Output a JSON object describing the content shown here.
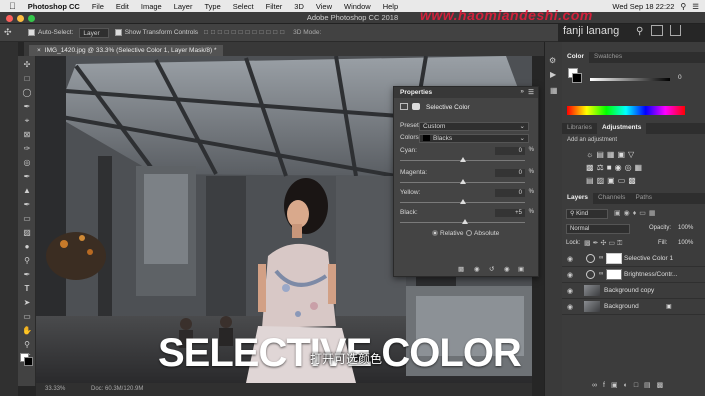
{
  "menubar": {
    "app_name": "Photoshop CC",
    "items": [
      "File",
      "Edit",
      "Image",
      "Layer",
      "Type",
      "Select",
      "Filter",
      "3D",
      "View",
      "Window",
      "Help"
    ],
    "clock": "Wed Sep 18  22:22"
  },
  "window": {
    "title": "Adobe Photoshop CC 2018",
    "watermark": "www.haomiandeshi.com"
  },
  "options": {
    "auto_select_label": "Auto-Select:",
    "auto_select_value": "Layer",
    "transform_label": "Show Transform Controls"
  },
  "user_name": "fanji lanang",
  "doc_tab": "IMG_1420.jpg @ 33.3% (Selective Color 1, Layer Mask/8) *",
  "status": {
    "zoom": "33.33%",
    "doc": "Doc: 60.3M/120.9M"
  },
  "color_panel": {
    "tabs": [
      "Color",
      "Swatches"
    ],
    "value": "0"
  },
  "adjust_panel": {
    "tabs": [
      "Libraries",
      "Adjustments"
    ],
    "add_label": "Add an adjustment"
  },
  "layers_panel": {
    "tabs": [
      "Layers",
      "Channels",
      "Paths"
    ],
    "filter": "Kind",
    "blend_mode": "Normal",
    "opacity_label": "Opacity:",
    "opacity": "100%",
    "lock_label": "Lock:",
    "fill_label": "Fill:",
    "fill": "100%",
    "layers": [
      {
        "name": "Selective Color 1"
      },
      {
        "name": "Brightness/Contr..."
      },
      {
        "name": "Background copy"
      },
      {
        "name": "Background"
      }
    ]
  },
  "properties": {
    "title": "Properties",
    "type": "Selective Color",
    "preset_label": "Preset:",
    "preset": "Custom",
    "colors_label": "Colors:",
    "colors": "Blacks",
    "sliders": [
      {
        "label": "Cyan:",
        "value": "0",
        "pos": 0.5
      },
      {
        "label": "Magenta:",
        "value": "0",
        "pos": 0.5
      },
      {
        "label": "Yellow:",
        "value": "0",
        "pos": 0.5
      },
      {
        "label": "Black:",
        "value": "+5",
        "pos": 0.52
      }
    ],
    "pct": "%",
    "relative": "Relative",
    "absolute": "Absolute"
  },
  "caption": {
    "title": "SELECTIVE COLOR",
    "subtitle": "打开可选颜色"
  }
}
